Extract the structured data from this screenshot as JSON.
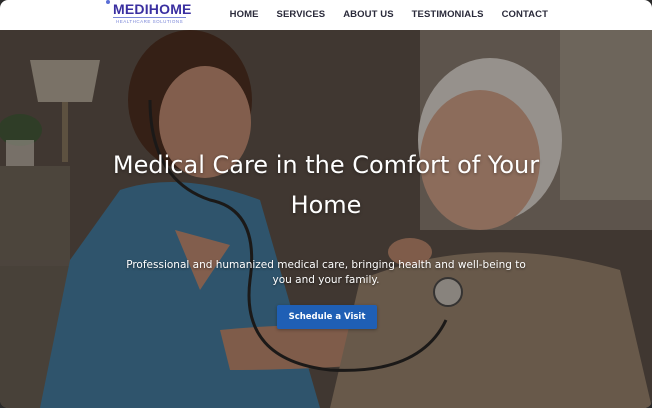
{
  "brand": {
    "name": "MEDIHOME",
    "tagline": "HEALTHCARE SOLUTIONS",
    "colors": {
      "primary": "#3a2fa0",
      "accent": "#7a86d8"
    }
  },
  "nav": {
    "items": [
      {
        "label": "HOME"
      },
      {
        "label": "SERVICES"
      },
      {
        "label": "ABOUT US"
      },
      {
        "label": "TESTIMONIALS"
      },
      {
        "label": "CONTACT"
      }
    ]
  },
  "hero": {
    "title": "Medical Care in the Comfort of Your Home",
    "subtitle": "Professional and humanized medical care, bringing health and well-being to you and your family.",
    "cta_label": "Schedule a Visit",
    "cta_color": "#1f5fb5",
    "image_semantic": "nurse-with-stethoscope-examining-elderly-man-photo"
  }
}
